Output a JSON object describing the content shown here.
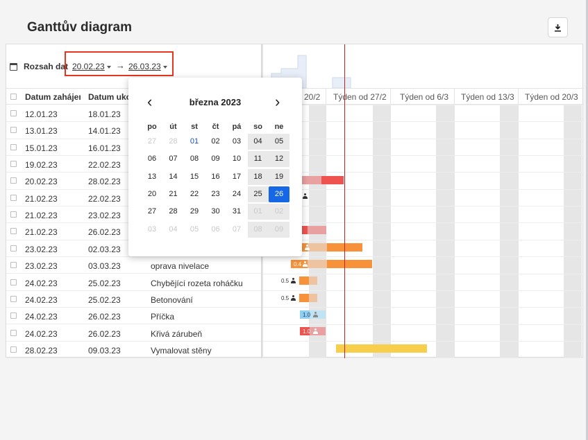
{
  "title": "Ganttův diagram",
  "range": {
    "label": "Rozsah dat",
    "from": "20.02.23",
    "to": "26.03.23",
    "arrow": "→"
  },
  "columns": {
    "start": "Datum zahájení",
    "end": "Datum ukončení"
  },
  "rows": [
    {
      "start": "12.01.23",
      "end": "18.01.23",
      "name": ""
    },
    {
      "start": "13.01.23",
      "end": "14.01.23",
      "name": ""
    },
    {
      "start": "15.01.23",
      "end": "16.01.23",
      "name": ""
    },
    {
      "start": "19.02.23",
      "end": "22.02.23",
      "name": ""
    },
    {
      "start": "20.02.23",
      "end": "28.02.23",
      "name": ""
    },
    {
      "start": "21.02.23",
      "end": "22.02.23",
      "name": ""
    },
    {
      "start": "21.02.23",
      "end": "23.02.23",
      "name": ""
    },
    {
      "start": "21.02.23",
      "end": "26.02.23",
      "name": ""
    },
    {
      "start": "23.02.23",
      "end": "02.03.23",
      "name": ""
    },
    {
      "start": "23.02.23",
      "end": "03.03.23",
      "name": "oprava nivelace"
    },
    {
      "start": "24.02.23",
      "end": "25.02.23",
      "name": "Chybějící rozeta roháčku"
    },
    {
      "start": "24.02.23",
      "end": "25.02.23",
      "name": "Betonování"
    },
    {
      "start": "24.02.23",
      "end": "26.02.23",
      "name": "Příčka"
    },
    {
      "start": "24.02.23",
      "end": "26.02.23",
      "name": "Křivá zárubeň"
    },
    {
      "start": "28.02.23",
      "end": "09.03.23",
      "name": "Vymalovat stěny"
    }
  ],
  "weeks": [
    "20/2",
    "Týden od 27/2",
    "Týden od 6/3",
    "Týden od 13/3",
    "Týden od 20/3"
  ],
  "bar_labels": {
    "r9": "0.4",
    "r10": "0.5",
    "r11": "0.5",
    "r12": "1.0",
    "r13": "1.0"
  },
  "calendar": {
    "month": "března 2023",
    "prev": "‹",
    "next": "›",
    "weekdays": [
      "po",
      "út",
      "st",
      "čt",
      "pá",
      "so",
      "ne"
    ],
    "weeks": [
      [
        "27",
        "28",
        "01",
        "02",
        "03",
        "04",
        "05"
      ],
      [
        "06",
        "07",
        "08",
        "09",
        "10",
        "11",
        "12"
      ],
      [
        "13",
        "14",
        "15",
        "16",
        "17",
        "18",
        "19"
      ],
      [
        "20",
        "21",
        "22",
        "23",
        "24",
        "25",
        "26"
      ],
      [
        "27",
        "28",
        "29",
        "30",
        "31",
        "01",
        "02"
      ],
      [
        "03",
        "04",
        "05",
        "06",
        "07",
        "08",
        "09"
      ]
    ],
    "selected": "26"
  },
  "colors": {
    "accent": "#1567e6",
    "today_line": "#cc1f1f",
    "bar_red": "#ef5350",
    "bar_orange": "#f7923a",
    "bar_yellow": "#f7cf4d",
    "bar_blue": "#8fd0ef",
    "highlight_box": "#e8351c"
  },
  "icons": {
    "download": "download-icon",
    "calendar": "calendar-icon",
    "person": "person-icon"
  }
}
